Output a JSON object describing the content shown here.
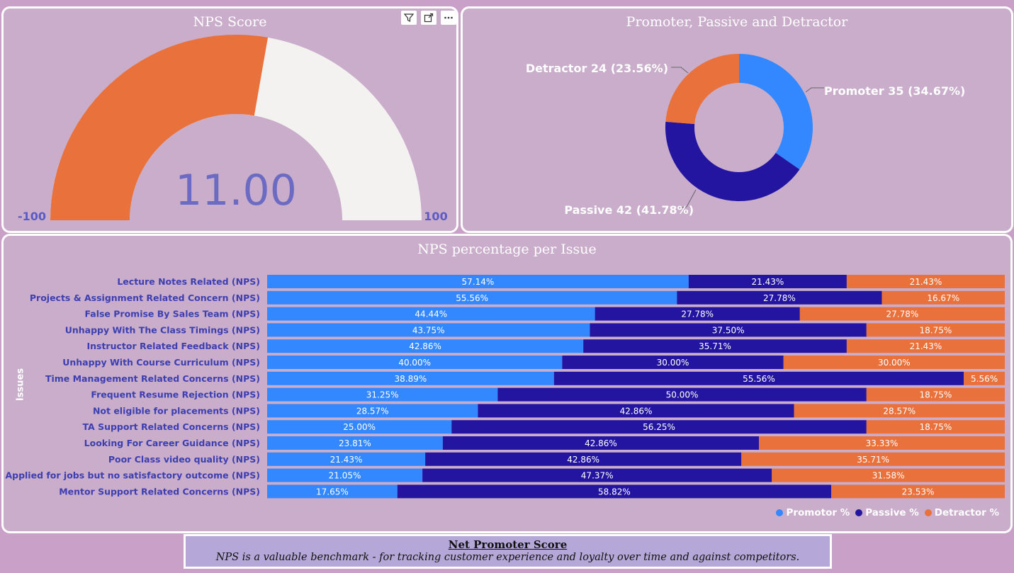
{
  "gauge": {
    "title": "NPS Score",
    "value_label": "11.00",
    "min_label": "-100",
    "max_label": "100",
    "value": 11,
    "min": -100,
    "max": 100,
    "fill_color": "#e8713c",
    "track_color": "#f3f2f1",
    "toolbar": [
      "filter-icon",
      "expand-icon",
      "more-options-icon"
    ]
  },
  "donut": {
    "title": "Promoter, Passive and Detractor",
    "slices": [
      {
        "label": "Promoter 35 (34.67%)",
        "value": 35,
        "color": "#3388ff"
      },
      {
        "label": "Passive 42 (41.78%)",
        "value": 42,
        "color": "#2415a0"
      },
      {
        "label": "Detractor 24 (23.56%)",
        "value": 24,
        "color": "#e8713c"
      }
    ]
  },
  "chart_data": {
    "type": "bar",
    "title": "NPS percentage per Issue",
    "ylabel": "Issues",
    "categories": [
      "Lecture Notes Related (NPS)",
      "Projects & Assignment Related Concern (NPS)",
      "False Promise By Sales Team (NPS)",
      "Unhappy With The Class Timings (NPS)",
      "Instructor Related Feedback (NPS)",
      "Unhappy With Course Curriculum (NPS)",
      "Time Management Related Concerns (NPS)",
      "Frequent Resume Rejection (NPS)",
      "Not eligible for placements (NPS)",
      "TA Support Related Concerns (NPS)",
      "Looking For Career Guidance (NPS)",
      "Poor Class video quality (NPS)",
      "Applied for jobs but no satisfactory outcome (NPS)",
      "Mentor Support Related Concerns (NPS)"
    ],
    "series": [
      {
        "name": "Promotor %",
        "color": "#3388ff",
        "values": [
          57.14,
          55.56,
          44.44,
          43.75,
          42.86,
          40.0,
          38.89,
          31.25,
          28.57,
          25.0,
          23.81,
          21.43,
          21.05,
          17.65
        ],
        "labels": [
          "57.14%",
          "55.56%",
          "44.44%",
          "43.75%",
          "42.86%",
          "40.00%",
          "38.89%",
          "31.25%",
          "28.57%",
          "25.00%",
          "23.81%",
          "21.43%",
          "21.05%",
          "17.65%"
        ]
      },
      {
        "name": "Passive %",
        "color": "#2415a0",
        "values": [
          21.43,
          27.78,
          27.78,
          37.5,
          35.71,
          30.0,
          55.56,
          50.0,
          42.86,
          56.25,
          42.86,
          42.86,
          47.37,
          58.82
        ],
        "labels": [
          "21.43%",
          "27.78%",
          "27.78%",
          "37.50%",
          "35.71%",
          "30.00%",
          "55.56%",
          "50.00%",
          "42.86%",
          "56.25%",
          "42.86%",
          "42.86%",
          "47.37%",
          "58.82%"
        ]
      },
      {
        "name": "Detractor %",
        "color": "#e8713c",
        "values": [
          21.43,
          16.67,
          27.78,
          18.75,
          21.43,
          30.0,
          5.56,
          18.75,
          28.57,
          18.75,
          33.33,
          35.71,
          31.58,
          23.53
        ],
        "labels": [
          "21.43%",
          "16.67%",
          "27.78%",
          "18.75%",
          "21.43%",
          "30.00%",
          "5.56%",
          "18.75%",
          "28.57%",
          "18.75%",
          "33.33%",
          "35.71%",
          "31.58%",
          "23.53%"
        ]
      }
    ],
    "stacked": true,
    "percent_stacked": true,
    "legend_position": "bottom-right",
    "category_label_color": "#3d3fb0"
  },
  "footer": {
    "title": "Net Promoter Score",
    "subtitle": "NPS is a valuable benchmark - for tracking customer experience and loyalty over time and against competitors."
  }
}
